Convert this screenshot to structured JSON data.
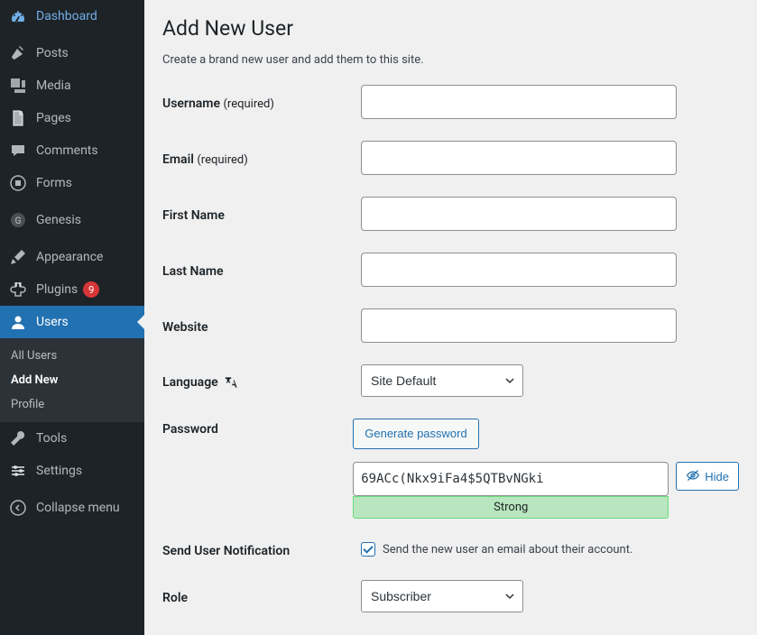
{
  "sidebar": {
    "dashboard": "Dashboard",
    "posts": "Posts",
    "media": "Media",
    "pages": "Pages",
    "comments": "Comments",
    "forms": "Forms",
    "genesis": "Genesis",
    "appearance": "Appearance",
    "plugins": "Plugins",
    "plugins_count": "9",
    "users": "Users",
    "tools": "Tools",
    "settings": "Settings",
    "collapse": "Collapse menu",
    "submenu": {
      "all_users": "All Users",
      "add_new": "Add New",
      "profile": "Profile"
    }
  },
  "page": {
    "title": "Add New User",
    "description": "Create a brand new user and add them to this site."
  },
  "fields": {
    "username_label": "Username",
    "username_req": "(required)",
    "email_label": "Email",
    "email_req": "(required)",
    "first_name_label": "First Name",
    "last_name_label": "Last Name",
    "website_label": "Website",
    "language_label": "Language",
    "language_value": "Site Default",
    "password_label": "Password",
    "generate_label": "Generate password",
    "password_value": "69ACc(Nkx9iFa4$5QTBvNGki",
    "strength_label": "Strong",
    "hide_label": "Hide",
    "notification_label": "Send User Notification",
    "notification_text": "Send the new user an email about their account.",
    "role_label": "Role",
    "role_value": "Subscriber"
  }
}
